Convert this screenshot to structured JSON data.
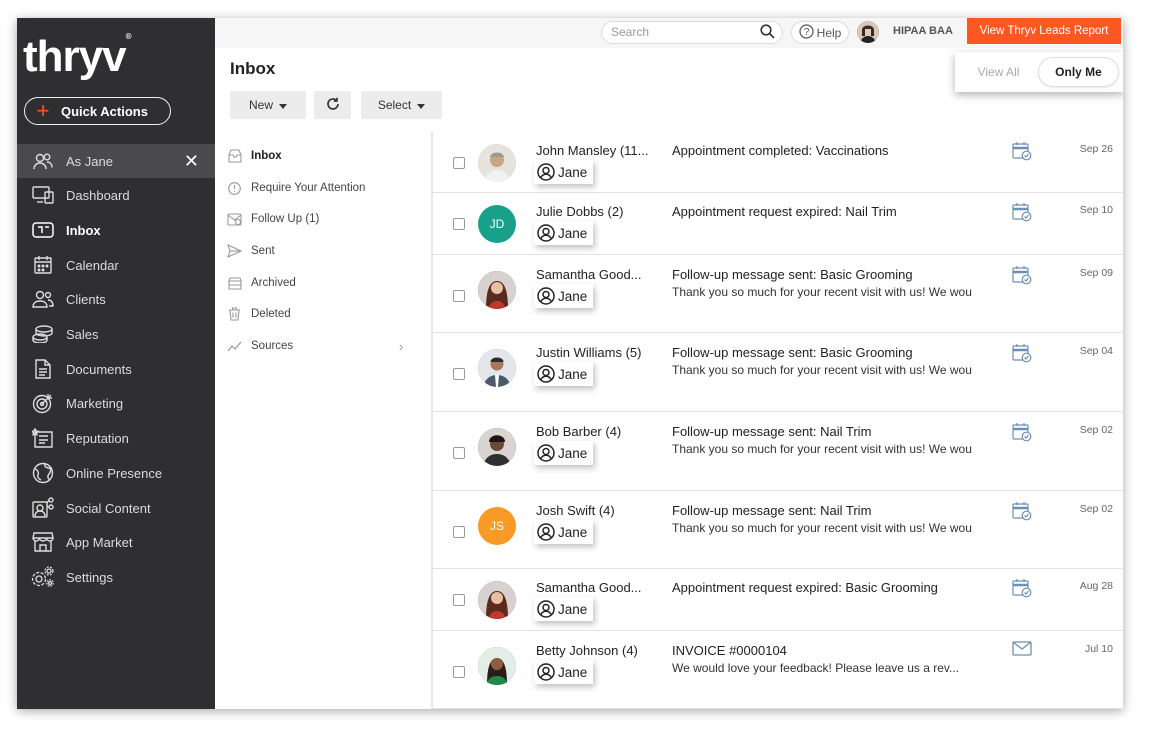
{
  "brand": {
    "logo_text": "thryv",
    "logo_mark": "®"
  },
  "sidebar": {
    "quick_actions": "Quick Actions",
    "items": [
      {
        "id": "asjane",
        "label": "As Jane",
        "icon": "users-icon"
      },
      {
        "id": "dashboard",
        "label": "Dashboard",
        "icon": "dashboard-icon"
      },
      {
        "id": "inbox",
        "label": "Inbox",
        "icon": "inbox-icon"
      },
      {
        "id": "calendar",
        "label": "Calendar",
        "icon": "calendar-icon"
      },
      {
        "id": "clients",
        "label": "Clients",
        "icon": "clients-icon"
      },
      {
        "id": "sales",
        "label": "Sales",
        "icon": "sales-icon"
      },
      {
        "id": "documents",
        "label": "Documents",
        "icon": "document-icon"
      },
      {
        "id": "marketing",
        "label": "Marketing",
        "icon": "target-icon"
      },
      {
        "id": "reputation",
        "label": "Reputation",
        "icon": "reputation-icon"
      },
      {
        "id": "online",
        "label": "Online Presence",
        "icon": "globe-icon"
      },
      {
        "id": "social",
        "label": "Social Content",
        "icon": "social-icon"
      },
      {
        "id": "appmarket",
        "label": "App Market",
        "icon": "store-icon"
      },
      {
        "id": "settings",
        "label": "Settings",
        "icon": "gear-icon"
      }
    ]
  },
  "topbar": {
    "search_placeholder": "Search",
    "help_label": "Help",
    "account_label": "HIPAA BAA",
    "leads_button": "View Thryv Leads Report"
  },
  "view_toggle": {
    "view_all": "View All",
    "only_me": "Only Me",
    "selected": "only_me"
  },
  "inbox": {
    "title": "Inbox",
    "new_label": "New",
    "select_label": "Select"
  },
  "folders": [
    {
      "label": "Inbox",
      "icon": "inbox-icon"
    },
    {
      "label": "Require Your Attention",
      "icon": "alert-icon"
    },
    {
      "label": "Follow Up (1)",
      "icon": "followup-icon"
    },
    {
      "label": "Sent",
      "icon": "sent-icon"
    },
    {
      "label": "Archived",
      "icon": "archive-icon"
    },
    {
      "label": "Deleted",
      "icon": "trash-icon"
    },
    {
      "label": "Sources",
      "icon": "chart-line-icon"
    }
  ],
  "messages": [
    {
      "name": "John Mansley (11...",
      "assignee": "Jane",
      "subject": "Appointment completed: Vaccinations",
      "preview": "",
      "date": "Sep 26",
      "type": "calendar-check-icon",
      "avatar_initials": "",
      "avatar_color": "#c8c2bb"
    },
    {
      "name": "Julie Dobbs (2)",
      "assignee": "Jane",
      "subject": "Appointment request expired: Nail Trim",
      "preview": "",
      "date": "Sep 10",
      "type": "calendar-check-icon",
      "avatar_initials": "JD",
      "avatar_color": "#17a08a"
    },
    {
      "name": "Samantha Good...",
      "assignee": "Jane",
      "subject": "Follow-up message sent: Basic Grooming",
      "preview": "Thank you so much for your recent visit with us! We wou",
      "date": "Sep 09",
      "type": "calendar-check-icon",
      "avatar_initials": "",
      "avatar_color": "#7a3b2e"
    },
    {
      "name": "Justin Williams (5)",
      "assignee": "Jane",
      "subject": "Follow-up message sent: Basic Grooming",
      "preview": "Thank you so much for your recent visit with us! We wou",
      "date": "Sep 04",
      "type": "calendar-check-icon",
      "avatar_initials": "",
      "avatar_color": "#5d6b7a"
    },
    {
      "name": "Bob Barber (4)",
      "assignee": "Jane",
      "subject": "Follow-up message sent: Nail Trim",
      "preview": "Thank you so much for your recent visit with us! We wou",
      "date": "Sep 02",
      "type": "calendar-check-icon",
      "avatar_initials": "",
      "avatar_color": "#4a3426"
    },
    {
      "name": "Josh Swift (4)",
      "assignee": "Jane",
      "subject": "Follow-up message sent: Nail Trim",
      "preview": "Thank you so much for your recent visit with us! We wou",
      "date": "Sep 02",
      "type": "calendar-check-icon",
      "avatar_initials": "JS",
      "avatar_color": "#f89a25"
    },
    {
      "name": "Samantha Good...",
      "assignee": "Jane",
      "subject": "Appointment request expired: Basic Grooming",
      "preview": "",
      "date": "Aug 28",
      "type": "calendar-check-icon",
      "avatar_initials": "",
      "avatar_color": "#7a3b2e"
    },
    {
      "name": "Betty Johnson (4)",
      "assignee": "Jane",
      "subject": "INVOICE #0000104",
      "preview": "We would love your feedback! Please leave us a rev...",
      "date": "Jul 10",
      "type": "envelope-icon",
      "avatar_initials": "",
      "avatar_color": "#2e8a5a"
    }
  ],
  "colors": {
    "accent": "#ff5722",
    "sidebar": "#2f2f31",
    "icon_blue": "#6c8fb5"
  }
}
